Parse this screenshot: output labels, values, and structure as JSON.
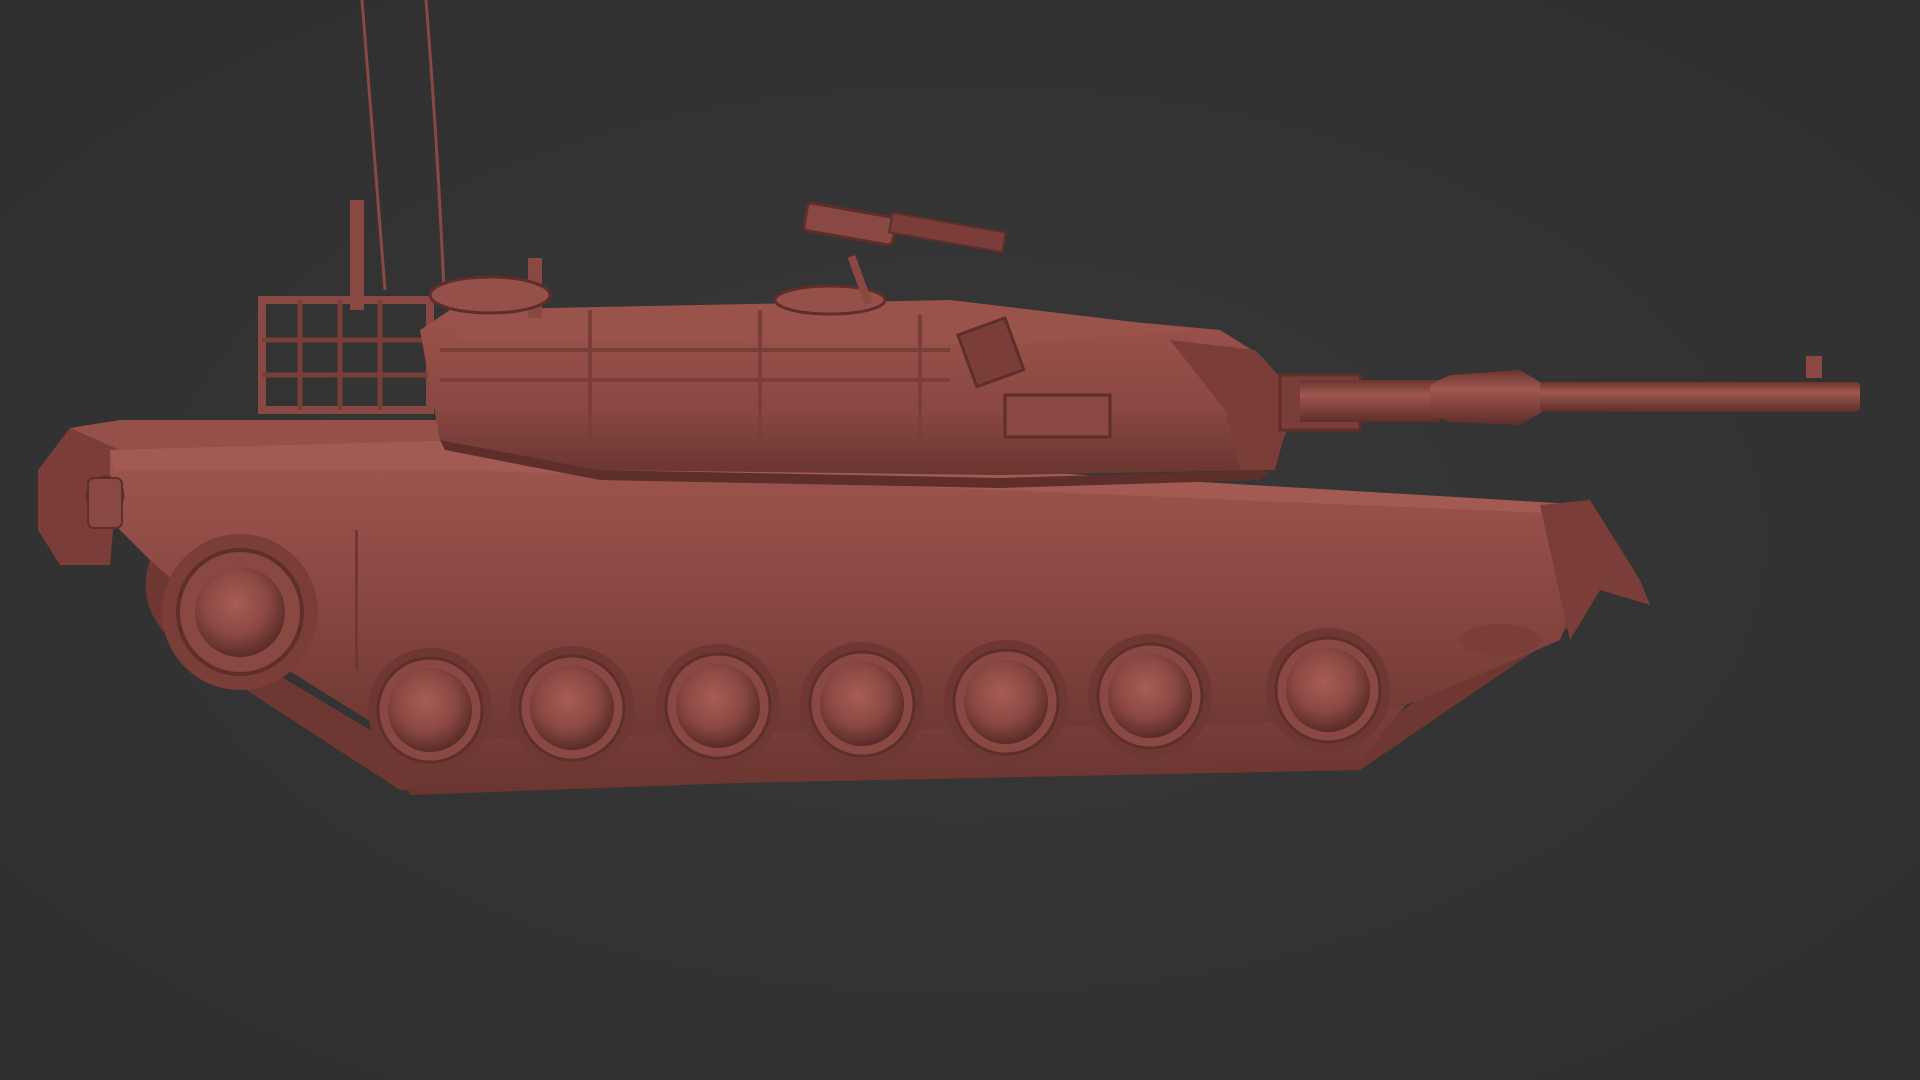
{
  "scene": {
    "background_color": "#333333",
    "model_color": "#8a4842",
    "model_highlight": "#a0574f",
    "model_shadow": "#5e2e2a",
    "model_dark": "#4a2320",
    "road_wheel_count": 7
  }
}
